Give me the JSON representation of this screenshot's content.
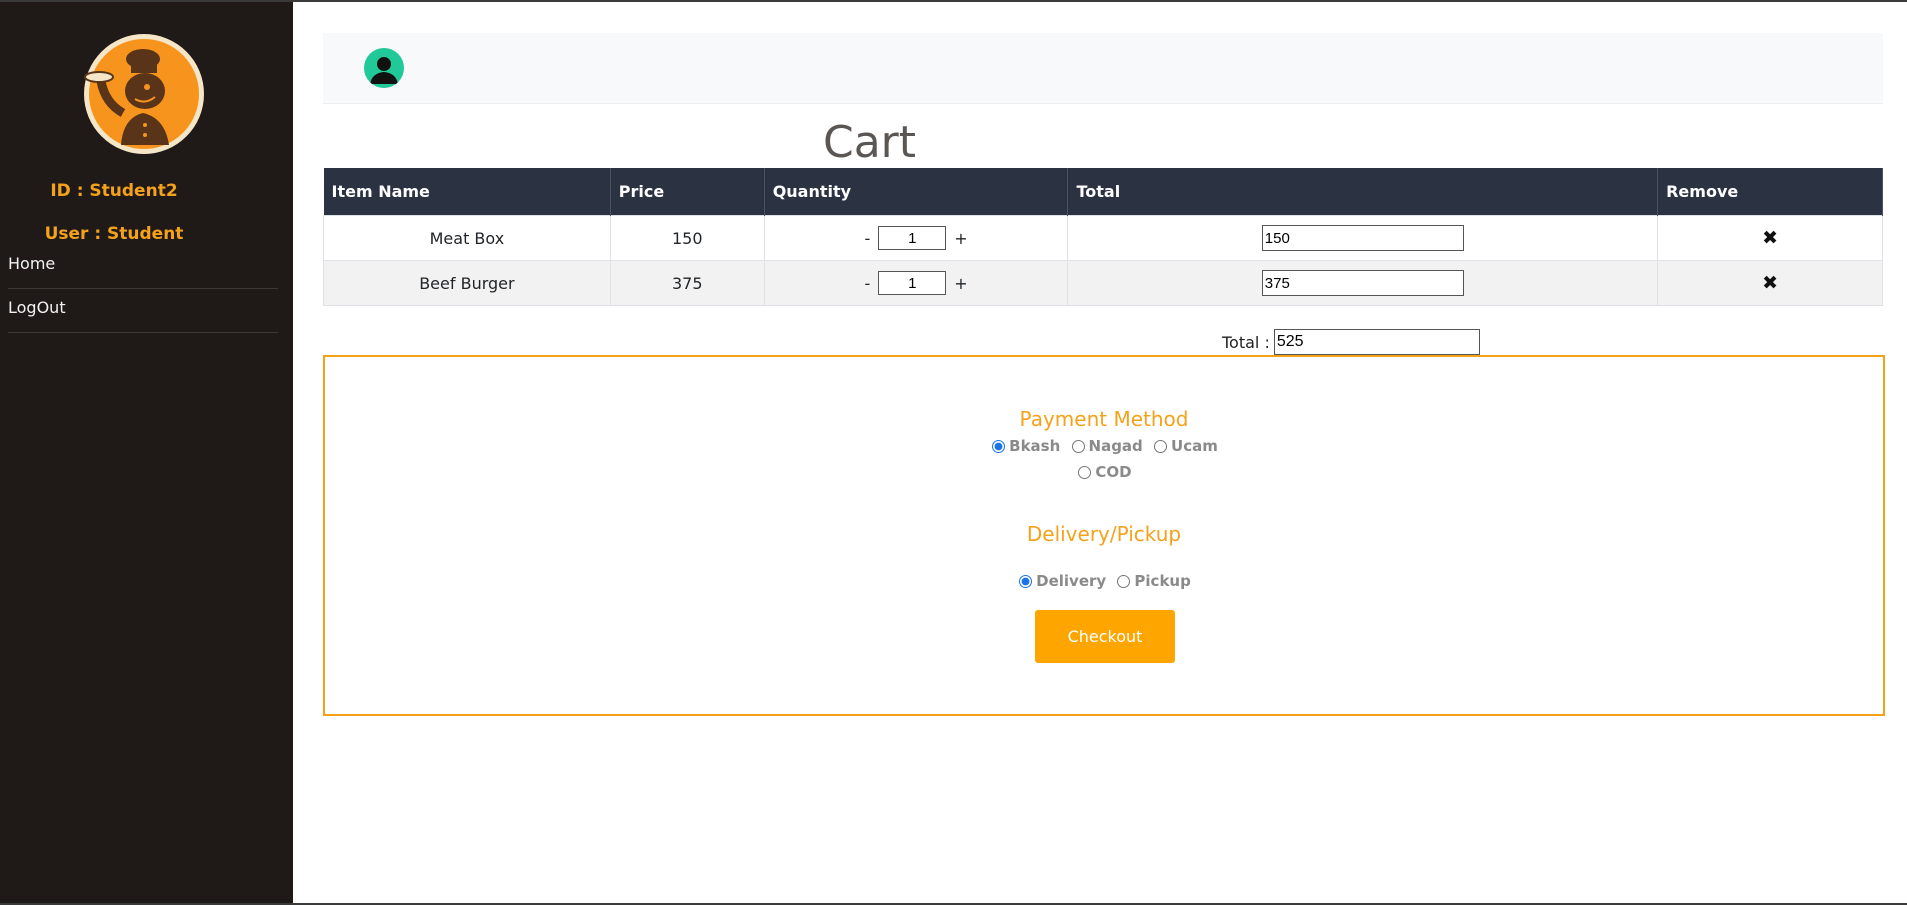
{
  "sidebar": {
    "id_label": "ID : Student2",
    "user_label": "User : Student",
    "nav": [
      {
        "label": "Home"
      },
      {
        "label": "LogOut"
      }
    ]
  },
  "colors": {
    "sidebar_bg": "#1f1a17",
    "accent": "#f5a21b",
    "table_header_bg": "#2b3242",
    "avatar_bg": "#20c997",
    "checkout_bg": "#ffa500"
  },
  "page": {
    "title": "Cart"
  },
  "table": {
    "headers": [
      "Item Name",
      "Price",
      "Quantity",
      "Total",
      "Remove"
    ],
    "rows": [
      {
        "name": "Meat Box",
        "price": "150",
        "qty": "1",
        "total": "150"
      },
      {
        "name": "Beef Burger",
        "price": "375",
        "qty": "1",
        "total": "375"
      }
    ],
    "minus": "-",
    "plus": "+",
    "remove_icon": "close-icon"
  },
  "summary": {
    "total_label": "Total :",
    "total_value": "525"
  },
  "checkout": {
    "payment_heading": "Payment Method",
    "payment_options": [
      "Bkash",
      "Nagad",
      "Ucam",
      "COD"
    ],
    "payment_selected": "Bkash",
    "delivery_heading": "Delivery/Pickup",
    "delivery_options": [
      "Delivery",
      "Pickup"
    ],
    "delivery_selected": "Delivery",
    "button_label": "Checkout"
  }
}
